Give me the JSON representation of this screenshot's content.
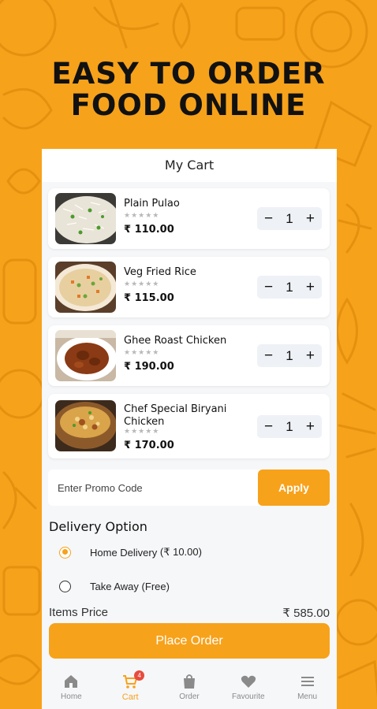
{
  "headline": {
    "line1": "EASY TO ORDER",
    "line2": "FOOD ONLINE"
  },
  "colors": {
    "accent": "#F7A21B",
    "background": "#F7A21B",
    "badge": "#E74C3C"
  },
  "app": {
    "title": "My Cart",
    "cart_items": [
      {
        "name": "Plain Pulao",
        "stars": "★★★★★",
        "price": "₹ 110.00",
        "qty": "1",
        "minus": "−",
        "plus": "+",
        "image": "plain-pulao-photo"
      },
      {
        "name": "Veg Fried Rice",
        "stars": "★★★★★",
        "price": "₹ 115.00",
        "qty": "1",
        "minus": "−",
        "plus": "+",
        "image": "veg-fried-rice-photo"
      },
      {
        "name": "Ghee Roast Chicken",
        "stars": "★★★★★",
        "price": "₹ 190.00",
        "qty": "1",
        "minus": "−",
        "plus": "+",
        "image": "ghee-roast-chicken-photo"
      },
      {
        "name": "Chef Special Biryani Chicken",
        "stars": "★★★★★",
        "price": "₹ 170.00",
        "qty": "1",
        "minus": "−",
        "plus": "+",
        "image": "biryani-photo"
      }
    ],
    "promo": {
      "placeholder": "Enter Promo Code",
      "apply_label": "Apply"
    },
    "delivery": {
      "title": "Delivery Option",
      "options": [
        {
          "label": "Home Delivery",
          "extra": "(₹ 10.00)",
          "selected": true
        },
        {
          "label": "Take Away",
          "extra": "(Free)",
          "selected": false
        }
      ]
    },
    "summary": {
      "items_price_label": "Items Price",
      "items_price_value": "₹ 585.00"
    },
    "place_order_label": "Place Order",
    "nav": [
      {
        "label": "Home",
        "icon": "home-icon",
        "active": false
      },
      {
        "label": "Cart",
        "icon": "cart-icon",
        "active": true,
        "badge": "4"
      },
      {
        "label": "Order",
        "icon": "bag-icon",
        "active": false
      },
      {
        "label": "Favourite",
        "icon": "heart-icon",
        "active": false
      },
      {
        "label": "Menu",
        "icon": "menu-icon",
        "active": false
      }
    ]
  }
}
